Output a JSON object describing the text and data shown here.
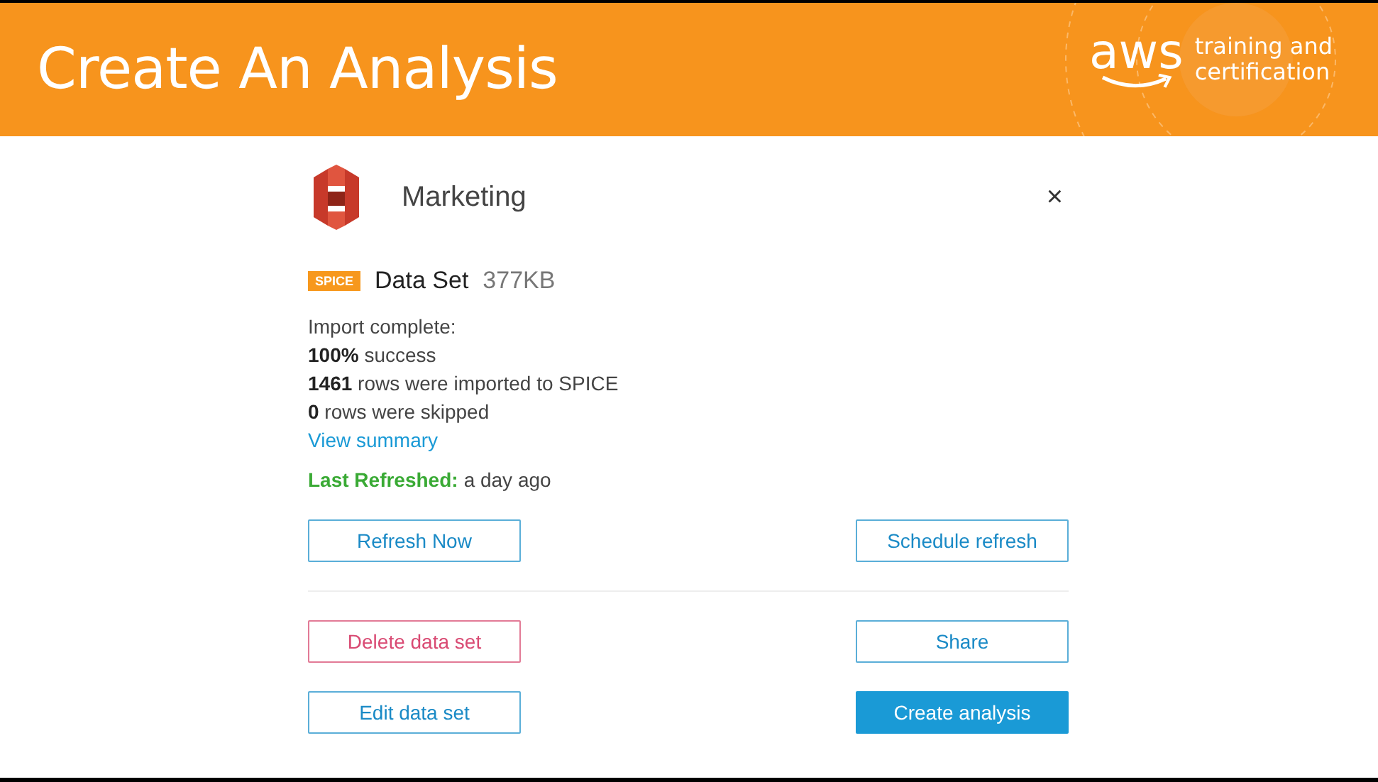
{
  "slide": {
    "title": "Create An Analysis",
    "logo": {
      "wordmark": "aws",
      "tagline": [
        "training and",
        "certification"
      ]
    }
  },
  "dialog": {
    "name": "Marketing",
    "close": "×",
    "badge": "SPICE",
    "dataset_label": "Data Set",
    "size": "377KB",
    "status_lines": [
      "Import complete:",
      "**100%** success",
      "**1461** rows were imported to SPICE",
      "**0** rows were skipped"
    ],
    "link": "View summary",
    "refreshed_label": "Last Refreshed:",
    "refreshed_value": "a day ago",
    "button_groups": [
      {
        "rows": [
          [
            {
              "label": "Refresh Now",
              "kind": "outline"
            },
            {
              "label": "Schedule refresh",
              "kind": "outline"
            }
          ]
        ]
      },
      {
        "rows": [
          [
            {
              "label": "Delete data set",
              "kind": "danger"
            },
            {
              "label": "Share",
              "kind": "outline"
            }
          ],
          [
            {
              "label": "Edit data set",
              "kind": "outline"
            },
            {
              "label": "Create analysis",
              "kind": "primary"
            }
          ]
        ]
      }
    ]
  }
}
